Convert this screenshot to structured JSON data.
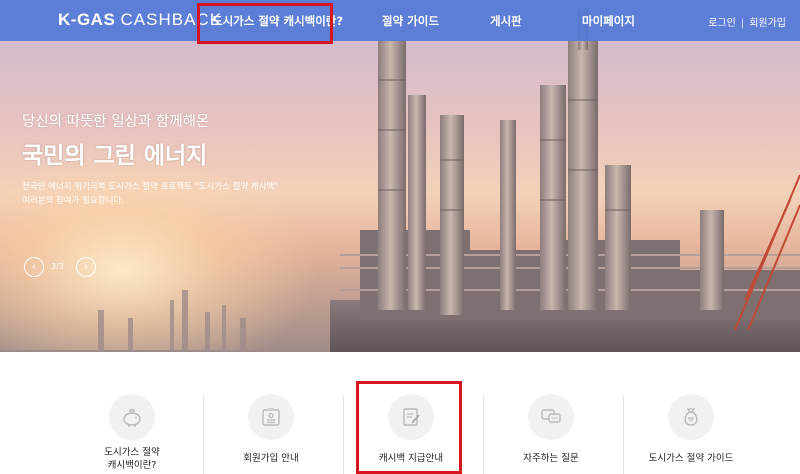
{
  "header": {
    "logo_bold": "K-GAS",
    "logo_light": "CASHBACK",
    "nav": [
      {
        "label": "도시가스 절약 캐시백이란?"
      },
      {
        "label": "절약 가이드"
      },
      {
        "label": "게시판"
      },
      {
        "label": "마이페이지"
      }
    ],
    "login": "로그인",
    "separator": "|",
    "signup": "회원가입"
  },
  "hero": {
    "subhead": "당신의 따뜻한 일상과 함께해온",
    "headline": "국민의 그린 에너지",
    "desc_line1": "전국민 에너지 위기극복 도시가스 절약 프로젝트 \"도시가스 절약 캐시백\"",
    "desc_line2": "여러분의 참여가 필요합니다.",
    "slide_counter": "3/3",
    "prev_symbol": "‹",
    "next_symbol": "›"
  },
  "quick_menu": [
    {
      "line1": "도시가스 절약",
      "line2": "캐시백이란?",
      "icon": "piggy-bank-icon"
    },
    {
      "line1": "회원가입 안내",
      "line2": "",
      "icon": "id-card-icon"
    },
    {
      "line1": "캐시백 지급안내",
      "line2": "",
      "icon": "document-pen-icon"
    },
    {
      "line1": "자주하는 질문",
      "line2": "",
      "icon": "chat-bubbles-icon"
    },
    {
      "line1": "도시가스 절약 가이드",
      "line2": "",
      "icon": "money-bag-icon"
    }
  ],
  "colors": {
    "nav_bg": "#5278d6",
    "highlight": "#d7151c",
    "icon_circle": "#f1f1f1"
  }
}
